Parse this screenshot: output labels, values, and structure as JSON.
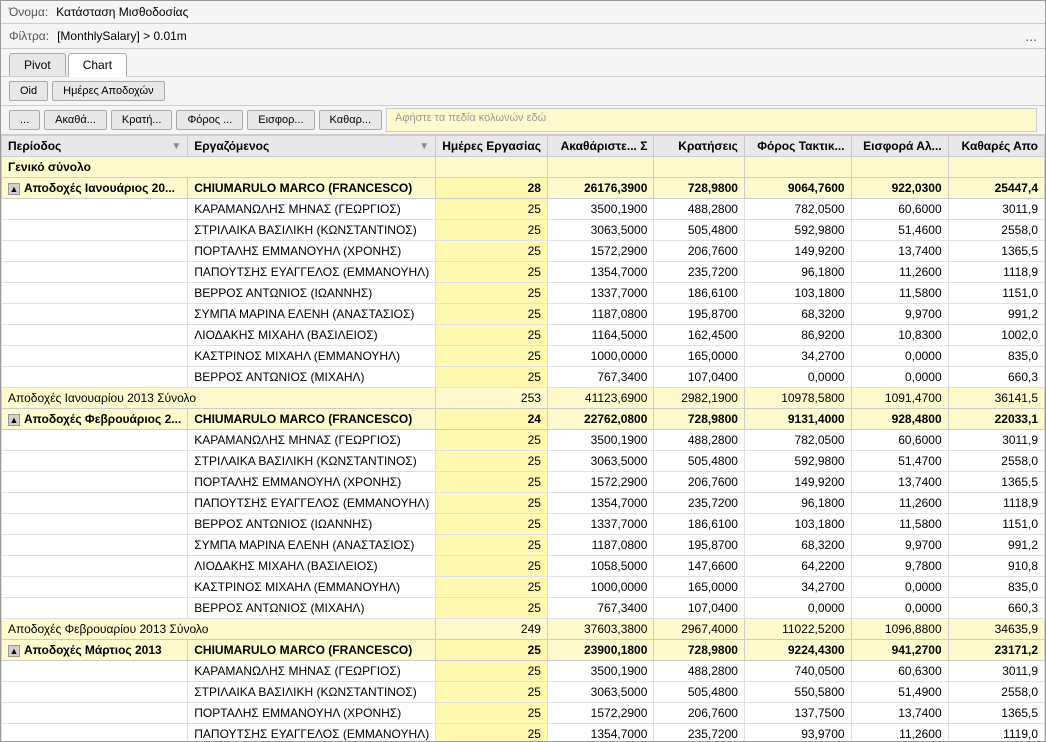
{
  "header": {
    "name_label": "Όνομα:",
    "name_value": "Κατάσταση Μισθοδοσίας",
    "filter_label": "Φίλτρα:",
    "filter_value": "[MonthlySalary] > 0.01m",
    "filter_dots": "..."
  },
  "tabs": [
    {
      "id": "pivot",
      "label": "Pivot",
      "active": false
    },
    {
      "id": "chart",
      "label": "Chart",
      "active": false
    }
  ],
  "field_selector": {
    "buttons": [
      "...",
      "Ακαθά...",
      "Κρατή...",
      "Φόρος ...",
      "Εισφορ...",
      "Καθαρ..."
    ],
    "drop_placeholder": "Αφήστε τα πεδία κολωνών εδώ"
  },
  "column_headers": {
    "row_fields": [
      {
        "label": "Oid"
      },
      {
        "label": "Ημέρες Αποδοχών"
      }
    ],
    "col1": "Περίοδος",
    "col2": "Εργαζόμενος",
    "col3": "Ημέρες Εργασίας",
    "col4": "Ακαθάριστε... Σ",
    "col5": "Κρατήσεις",
    "col6": "Φόρος Τακτικ...",
    "col7": "Εισφορά Αλ...",
    "col8": "Καθαρές Απο",
    "grand_total_label": "Γενικό σύνολο"
  },
  "rows": [
    {
      "type": "group_header",
      "period": "Αποδοχές Ιανουάριος 20...",
      "employee": "CHIUMARULO MARCO (FRANCESCO)",
      "days": "28",
      "gross": "26176,3900",
      "deductions": "728,9800",
      "tax": "9064,7600",
      "contribution": "922,0300",
      "net": "25447,4",
      "indent": true
    },
    {
      "type": "data",
      "employee": "ΚΑΡΑΜΑΝΩΛΗΣ ΜΗΝΑΣ (ΓΕΩΡΓΙΟΣ)",
      "days": "25",
      "gross": "3500,1900",
      "deductions": "488,2800",
      "tax": "782,0500",
      "contribution": "60,6000",
      "net": "3011,9"
    },
    {
      "type": "data",
      "employee": "ΣΤΡΙΛΑΙΚΑ ΒΑΣΙΛΙΚΗ (ΚΩΝΣΤΑΝΤΙΝΟΣ)",
      "days": "25",
      "gross": "3063,5000",
      "deductions": "505,4800",
      "tax": "592,9800",
      "contribution": "51,4600",
      "net": "2558,0"
    },
    {
      "type": "data",
      "employee": "ΠΟΡΤΑΛΗΣ ΕΜΜΑΝΟΥΗΛ (ΧΡΟΝΗΣ)",
      "days": "25",
      "gross": "1572,2900",
      "deductions": "206,7600",
      "tax": "149,9200",
      "contribution": "13,7400",
      "net": "1365,5"
    },
    {
      "type": "data",
      "employee": "ΠΑΠΟΥΤΣΗΣ ΕΥΑΓΓΕΛΟΣ (ΕΜΜΑΝΟΥΗΛ)",
      "days": "25",
      "gross": "1354,7000",
      "deductions": "235,7200",
      "tax": "96,1800",
      "contribution": "11,2600",
      "net": "1118,9"
    },
    {
      "type": "data",
      "employee": "ΒΕΡΡΟΣ  ΑΝΤΩΝΙΟΣ (ΙΩΑΝΝΗΣ)",
      "days": "25",
      "gross": "1337,7000",
      "deductions": "186,6100",
      "tax": "103,1800",
      "contribution": "11,5800",
      "net": "1151,0"
    },
    {
      "type": "data",
      "employee": "ΣΥΜΠΑ ΜΑΡΙΝΑ ΕΛΕΝΗ (ΑΝΑΣΤΑΣΙΟΣ)",
      "days": "25",
      "gross": "1187,0800",
      "deductions": "195,8700",
      "tax": "68,3200",
      "contribution": "9,9700",
      "net": "991,2"
    },
    {
      "type": "data",
      "employee": "ΛΙΟΔΑΚΗΣ ΜΙΧΑΗΛ (ΒΑΣΙΛΕΙΟΣ)",
      "days": "25",
      "gross": "1164,5000",
      "deductions": "162,4500",
      "tax": "86,9200",
      "contribution": "10,8300",
      "net": "1002,0"
    },
    {
      "type": "data",
      "employee": "ΚΑΣΤΡΙΝΟΣ ΜΙΧΑΗΛ (ΕΜΜΑΝΟΥΗΛ)",
      "days": "25",
      "gross": "1000,0000",
      "deductions": "165,0000",
      "tax": "34,2700",
      "contribution": "0,0000",
      "net": "835,0"
    },
    {
      "type": "data",
      "employee": "ΒΕΡΡΟΣ ΑΝΤΩΝΙΟΣ (ΜΙΧΑΗΛ)",
      "days": "25",
      "gross": "767,3400",
      "deductions": "107,0400",
      "tax": "0,0000",
      "contribution": "0,0000",
      "net": "660,3"
    },
    {
      "type": "subtotal",
      "label": "Αποδοχές Ιανουαρίου 2013 Σύνολο",
      "days": "253",
      "gross": "41123,6900",
      "deductions": "2982,1900",
      "tax": "10978,5800",
      "contribution": "1091,4700",
      "net": "36141,5"
    },
    {
      "type": "group_header",
      "period": "Αποδοχές Φεβρουάριος 2...",
      "employee": "CHIUMARULO MARCO (FRANCESCO)",
      "days": "24",
      "gross": "22762,0800",
      "deductions": "728,9800",
      "tax": "9131,4000",
      "contribution": "928,4800",
      "net": "22033,1",
      "indent": true
    },
    {
      "type": "data",
      "employee": "ΚΑΡΑΜΑΝΩΛΗΣ ΜΗΝΑΣ (ΓΕΩΡΓΙΟΣ)",
      "days": "25",
      "gross": "3500,1900",
      "deductions": "488,2800",
      "tax": "782,0500",
      "contribution": "60,6000",
      "net": "3011,9"
    },
    {
      "type": "data",
      "employee": "ΣΤΡΙΛΑΙΚΑ ΒΑΣΙΛΙΚΗ (ΚΩΝΣΤΑΝΤΙΝΟΣ)",
      "days": "25",
      "gross": "3063,5000",
      "deductions": "505,4800",
      "tax": "592,9800",
      "contribution": "51,4700",
      "net": "2558,0"
    },
    {
      "type": "data",
      "employee": "ΠΟΡΤΑΛΗΣ ΕΜΜΑΝΟΥΗΛ (ΧΡΟΝΗΣ)",
      "days": "25",
      "gross": "1572,2900",
      "deductions": "206,7600",
      "tax": "149,9200",
      "contribution": "13,7400",
      "net": "1365,5"
    },
    {
      "type": "data",
      "employee": "ΠΑΠΟΥΤΣΗΣ ΕΥΑΓΓΕΛΟΣ (ΕΜΜΑΝΟΥΗΛ)",
      "days": "25",
      "gross": "1354,7000",
      "deductions": "235,7200",
      "tax": "96,1800",
      "contribution": "11,2600",
      "net": "1118,9"
    },
    {
      "type": "data",
      "employee": "ΒΕΡΡΟΣ  ΑΝΤΩΝΙΟΣ (ΙΩΑΝΝΗΣ)",
      "days": "25",
      "gross": "1337,7000",
      "deductions": "186,6100",
      "tax": "103,1800",
      "contribution": "11,5800",
      "net": "1151,0"
    },
    {
      "type": "data",
      "employee": "ΣΥΜΠΑ ΜΑΡΙΝΑ ΕΛΕΝΗ (ΑΝΑΣΤΑΣΙΟΣ)",
      "days": "25",
      "gross": "1187,0800",
      "deductions": "195,8700",
      "tax": "68,3200",
      "contribution": "9,9700",
      "net": "991,2"
    },
    {
      "type": "data",
      "employee": "ΛΙΟΔΑΚΗΣ ΜΙΧΑΗΛ (ΒΑΣΙΛΕΙΟΣ)",
      "days": "25",
      "gross": "1058,5000",
      "deductions": "147,6600",
      "tax": "64,2200",
      "contribution": "9,7800",
      "net": "910,8"
    },
    {
      "type": "data",
      "employee": "ΚΑΣΤΡΙΝΟΣ ΜΙΧΑΗΛ (ΕΜΜΑΝΟΥΗΛ)",
      "days": "25",
      "gross": "1000,0000",
      "deductions": "165,0000",
      "tax": "34,2700",
      "contribution": "0,0000",
      "net": "835,0"
    },
    {
      "type": "data",
      "employee": "ΒΕΡΡΟΣ ΑΝΤΩΝΙΟΣ (ΜΙΧΑΗΛ)",
      "days": "25",
      "gross": "767,3400",
      "deductions": "107,0400",
      "tax": "0,0000",
      "contribution": "0,0000",
      "net": "660,3"
    },
    {
      "type": "subtotal",
      "label": "Αποδοχές Φεβρουαρίου 2013 Σύνολο",
      "days": "249",
      "gross": "37603,3800",
      "deductions": "2967,4000",
      "tax": "11022,5200",
      "contribution": "1096,8800",
      "net": "34635,9"
    },
    {
      "type": "group_header",
      "period": "Αποδοχές Μάρτιος 2013",
      "employee": "CHIUMARULO MARCO (FRANCESCO)",
      "days": "25",
      "gross": "23900,1800",
      "deductions": "728,9800",
      "tax": "9224,4300",
      "contribution": "941,2700",
      "net": "23171,2",
      "indent": true
    },
    {
      "type": "data",
      "employee": "ΚΑΡΑΜΑΝΩΛΗΣ ΜΗΝΑΣ (ΓΕΩΡΓΙΟΣ)",
      "days": "25",
      "gross": "3500,1900",
      "deductions": "488,2800",
      "tax": "740,0500",
      "contribution": "60,6300",
      "net": "3011,9"
    },
    {
      "type": "data",
      "employee": "ΣΤΡΙΛΑΙΚΑ ΒΑΣΙΛΙΚΗ (ΚΩΝΣΤΑΝΤΙΝΟΣ)",
      "days": "25",
      "gross": "3063,5000",
      "deductions": "505,4800",
      "tax": "550,5800",
      "contribution": "51,4900",
      "net": "2558,0"
    },
    {
      "type": "data",
      "employee": "ΠΟΡΤΑΛΗΣ ΕΜΜΑΝΟΥΗΛ (ΧΡΟΝΗΣ)",
      "days": "25",
      "gross": "1572,2900",
      "deductions": "206,7600",
      "tax": "137,7500",
      "contribution": "13,7400",
      "net": "1365,5"
    },
    {
      "type": "data",
      "employee": "ΠΑΠΟΥΤΣΗΣ ΕΥΑΓΓΕΛΟΣ (ΕΜΜΑΝΟΥΗΛ)",
      "days": "25",
      "gross": "1354,7000",
      "deductions": "235,7200",
      "tax": "93,9700",
      "contribution": "11,2600",
      "net": "1119,0"
    }
  ]
}
